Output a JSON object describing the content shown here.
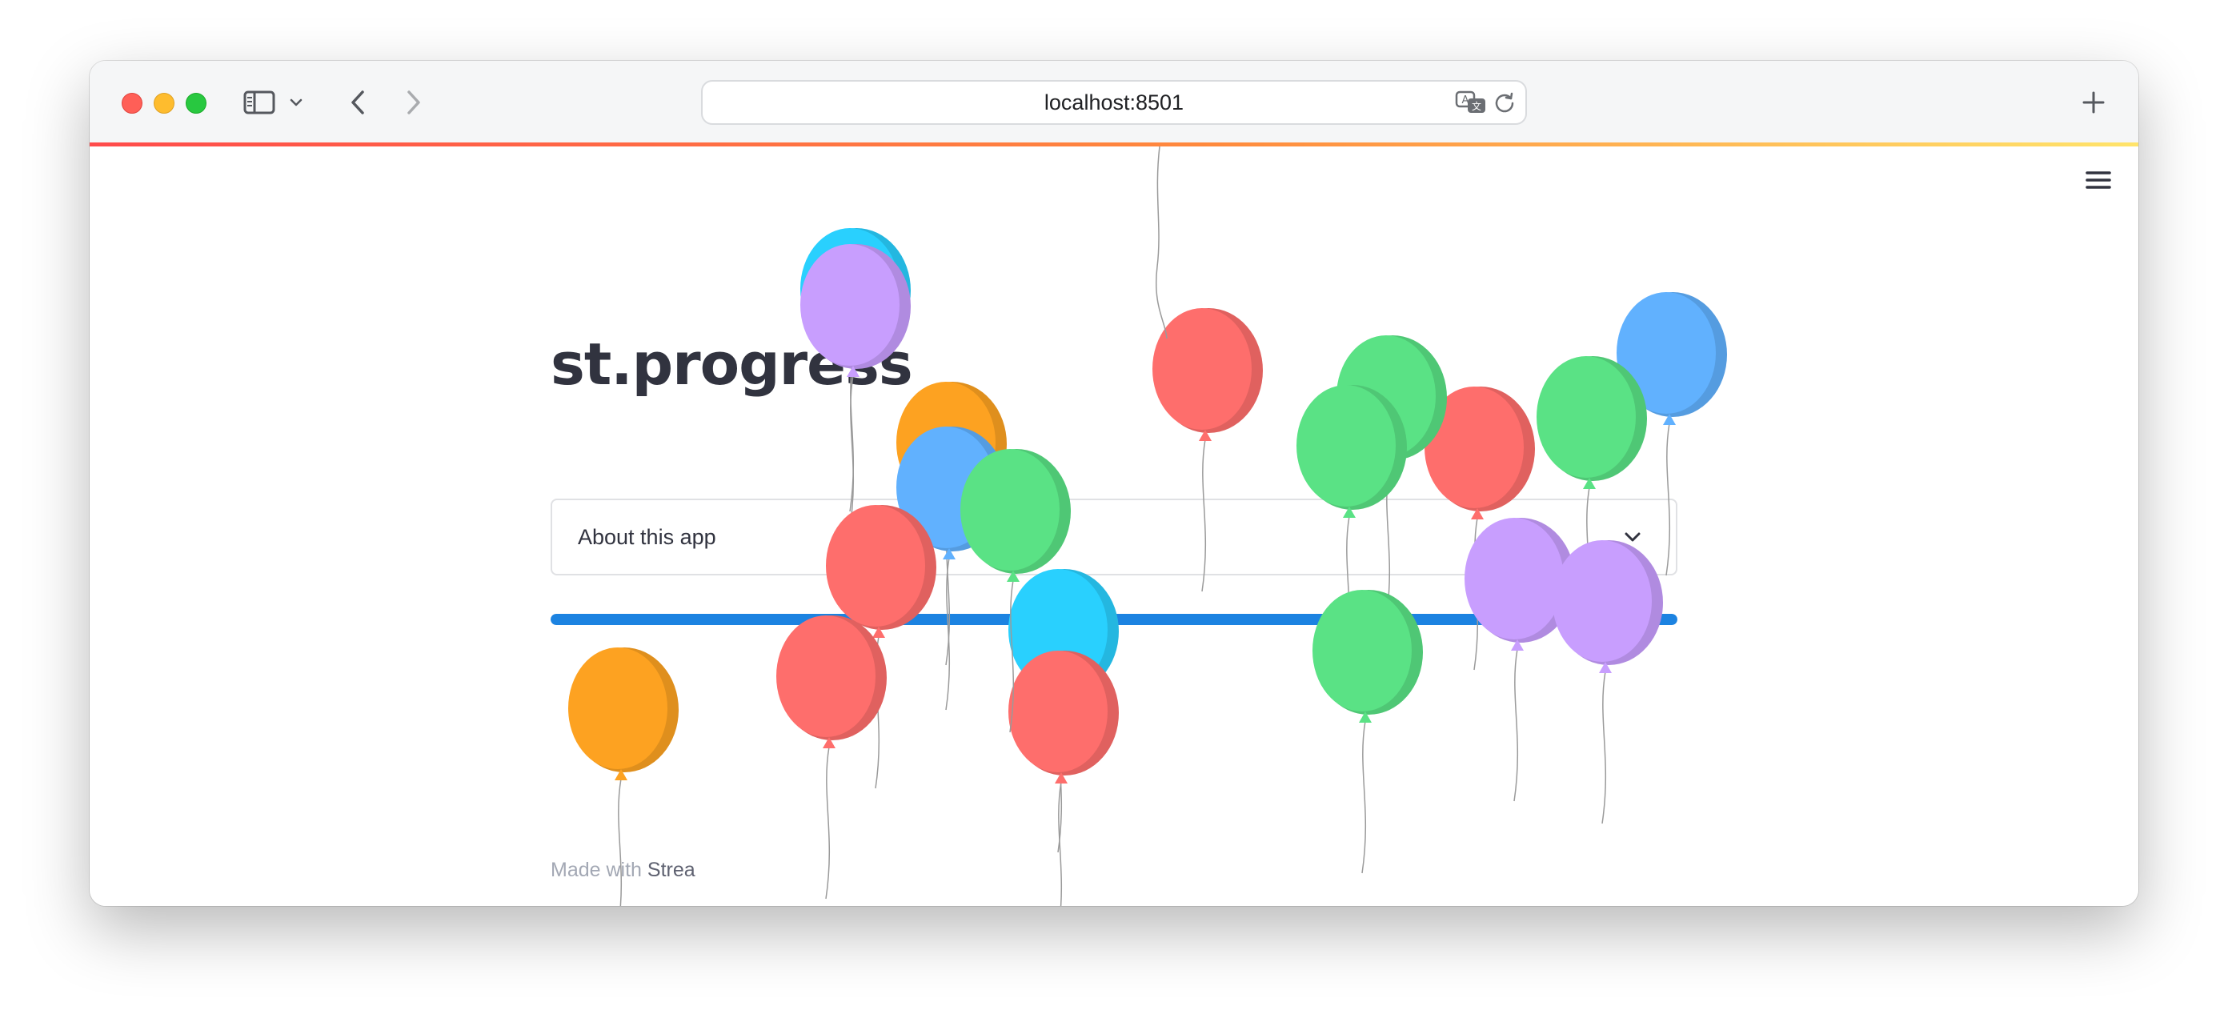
{
  "browser": {
    "url": "localhost:8501",
    "colors": {
      "close": "#ff5f57",
      "minimize": "#febc2e",
      "maximize": "#28c840",
      "loading_gradient": [
        "#ff4b4b",
        "#ff8a3d",
        "#ffe46b"
      ]
    },
    "icons": [
      "sidebar-toggle-icon",
      "chevron-down-icon",
      "back-arrow-icon",
      "forward-arrow-icon",
      "translate-icon",
      "reload-icon",
      "plus-icon"
    ]
  },
  "app": {
    "title": "st.progress",
    "expander": {
      "label": "About this app",
      "icon": "chevron-down-icon"
    },
    "progress": {
      "value_percent": 100,
      "color": "#1c83e1"
    },
    "footer": {
      "prefix": "Made with ",
      "link_text": "Strea"
    },
    "menu_icon": "hamburger-menu-icon",
    "balloon_colors": [
      "#29d0fe",
      "#c89efe",
      "#fda221",
      "#61b1fe",
      "#5ae285",
      "#fe6e6c"
    ]
  }
}
